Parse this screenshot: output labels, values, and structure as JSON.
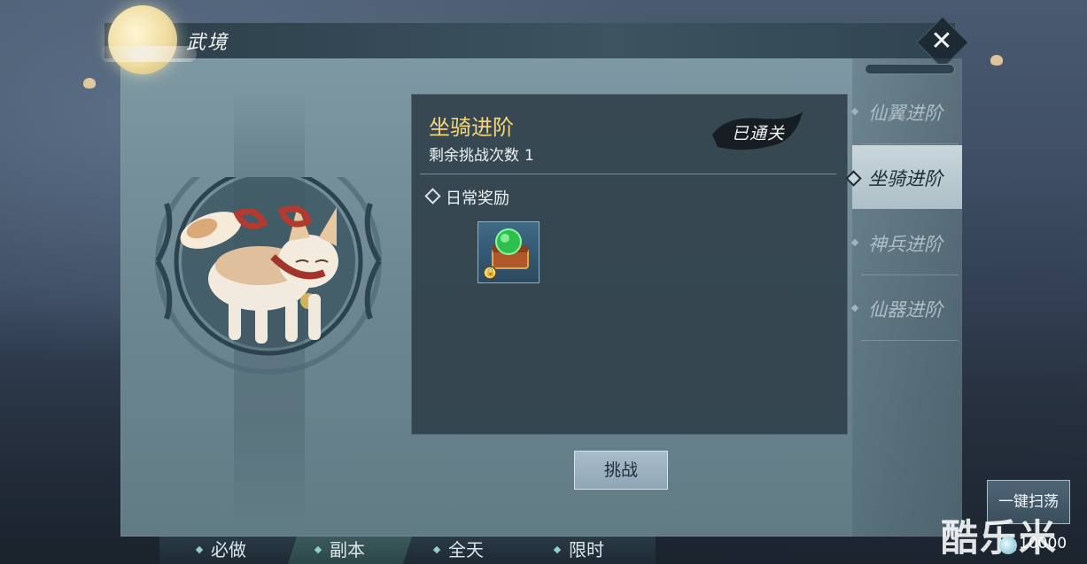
{
  "window": {
    "title": "武境"
  },
  "stage": {
    "name": "坐骑进阶",
    "remaining_label": "剩余挑战次数",
    "remaining_count": "1",
    "cleared_stamp": "已通关"
  },
  "rewards": {
    "header": "日常奖励",
    "items": [
      {
        "icon": "jade-chest-icon",
        "locked": true
      }
    ]
  },
  "challenge_button": "挑战",
  "side_tabs": [
    {
      "label": "仙翼进阶",
      "active": false
    },
    {
      "label": "坐骑进阶",
      "active": true
    },
    {
      "label": "神兵进阶",
      "active": false
    },
    {
      "label": "仙器进阶",
      "active": false
    }
  ],
  "bottom_nav": [
    {
      "label": "必做",
      "active": false
    },
    {
      "label": "副本",
      "active": true
    },
    {
      "label": "全天",
      "active": false
    },
    {
      "label": "限时",
      "active": false
    }
  ],
  "sweep_button": "一键扫荡",
  "currency": {
    "amount": "10000",
    "icon": "spirit-orb-icon"
  },
  "watermark": "酷乐米",
  "colors": {
    "stage_name": "#f4d57a",
    "active_tab": "#c9d6dc",
    "accent": "#8fd0c8"
  }
}
